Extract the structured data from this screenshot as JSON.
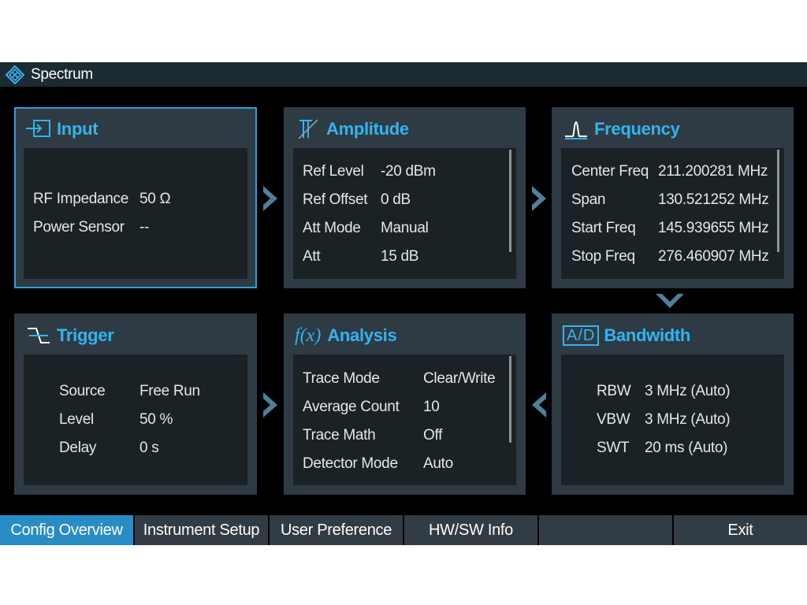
{
  "window": {
    "title": "Spectrum"
  },
  "panels": {
    "input": {
      "title": "Input",
      "rows": [
        {
          "label": "RF Impedance",
          "value": "50 Ω"
        },
        {
          "label": "Power Sensor",
          "value": "--"
        }
      ]
    },
    "amplitude": {
      "title": "Amplitude",
      "rows": [
        {
          "label": "Ref Level",
          "value": "-20 dBm"
        },
        {
          "label": "Ref Offset",
          "value": "0 dB"
        },
        {
          "label": "Att Mode",
          "value": "Manual"
        },
        {
          "label": "Att",
          "value": "15 dB"
        }
      ]
    },
    "frequency": {
      "title": "Frequency",
      "rows": [
        {
          "label": "Center Freq",
          "value": "211.200281 MHz"
        },
        {
          "label": "Span",
          "value": "130.521252 MHz"
        },
        {
          "label": "Start Freq",
          "value": "145.939655 MHz"
        },
        {
          "label": "Stop Freq",
          "value": "276.460907 MHz"
        }
      ]
    },
    "trigger": {
      "title": "Trigger",
      "rows": [
        {
          "label": "Source",
          "value": "Free Run"
        },
        {
          "label": "Level",
          "value": "50 %"
        },
        {
          "label": "Delay",
          "value": "0 s"
        }
      ]
    },
    "analysis": {
      "title": "Analysis",
      "icon_text": "f(x)",
      "rows": [
        {
          "label": "Trace Mode",
          "value": "Clear/Write"
        },
        {
          "label": "Average Count",
          "value": "10"
        },
        {
          "label": "Trace Math",
          "value": "Off"
        },
        {
          "label": "Detector Mode",
          "value": "Auto"
        }
      ]
    },
    "bandwidth": {
      "title": "Bandwidth",
      "icon_text": "A/D",
      "rows": [
        {
          "label": "RBW",
          "value": "3 MHz (Auto)"
        },
        {
          "label": "VBW",
          "value": "3 MHz (Auto)"
        },
        {
          "label": "SWT",
          "value": "20 ms (Auto)"
        }
      ]
    }
  },
  "tabs": [
    {
      "label": "Config Overview",
      "active": true
    },
    {
      "label": "Instrument Setup",
      "active": false
    },
    {
      "label": "User Preference",
      "active": false
    },
    {
      "label": "HW/SW Info",
      "active": false
    },
    {
      "label": "",
      "active": false
    },
    {
      "label": "Exit",
      "active": false
    }
  ],
  "colors": {
    "accent": "#33b4ef",
    "panel": "#2e3b44",
    "panel_body": "#1b2226",
    "tab_active": "#2a8cc4",
    "arrow": "#4f7f9b"
  }
}
